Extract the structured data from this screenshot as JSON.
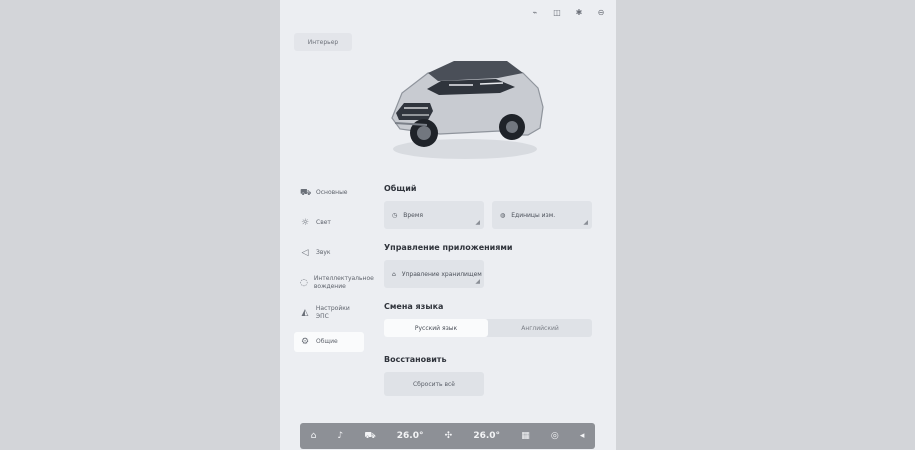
{
  "status_icons": [
    "wifi-icon",
    "signal-icon",
    "bluetooth-icon",
    "settings-icon"
  ],
  "model_select": {
    "label": "Интерьер"
  },
  "sidebar": {
    "items": [
      {
        "label": "Основные",
        "icon": "car-icon"
      },
      {
        "label": "Свет",
        "icon": "light-icon"
      },
      {
        "label": "Звук",
        "icon": "sound-icon"
      },
      {
        "label": "Интеллектуальное вождение",
        "icon": "drive-icon"
      },
      {
        "label": "Настройки ЭПС",
        "icon": "vehicle-icon"
      },
      {
        "label": "Общие",
        "icon": "settings-icon",
        "active": true
      }
    ]
  },
  "general": {
    "title": "Общий",
    "time_label": "Время",
    "units_label": "Единицы изм."
  },
  "apps": {
    "title": "Управление приложениями",
    "manage_label": "Управление хранилищем"
  },
  "language": {
    "title": "Смена языка",
    "russian": "Русский язык",
    "english": "Английский"
  },
  "restore": {
    "title": "Восстановить",
    "reset_label": "Сбросить всё"
  },
  "dock": {
    "left_temp": "26.0°",
    "right_temp": "26.0°"
  }
}
